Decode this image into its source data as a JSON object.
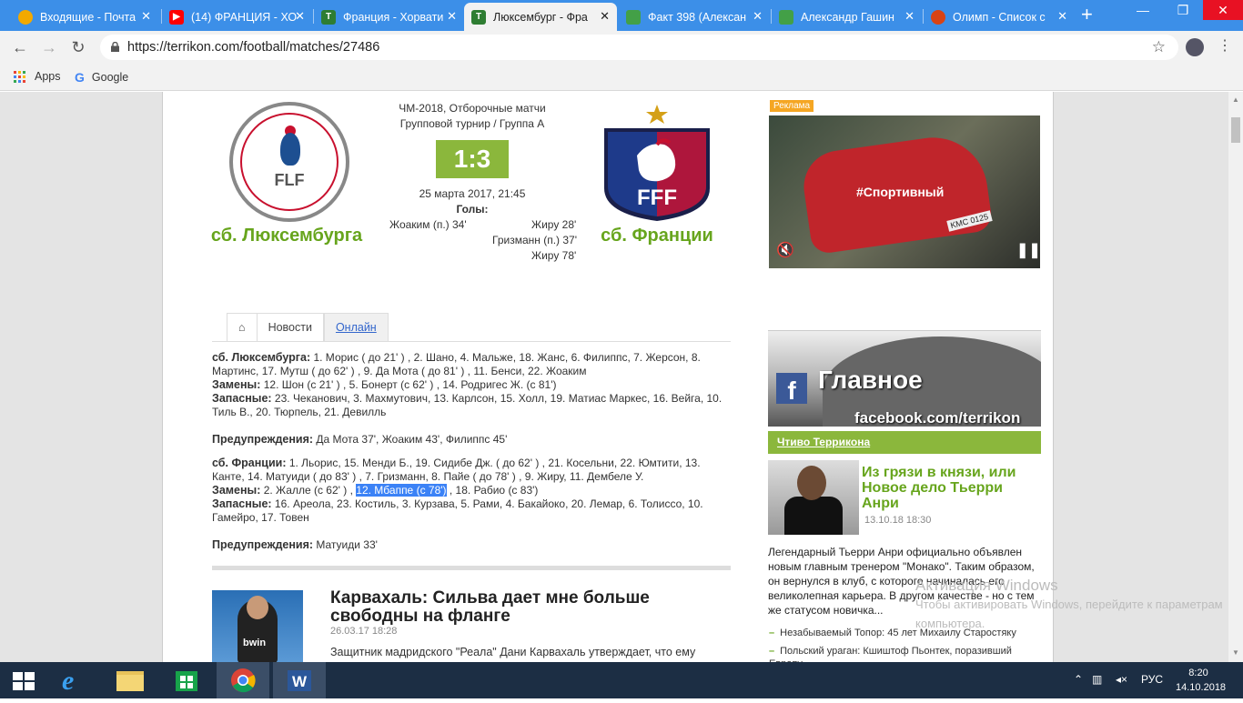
{
  "browser": {
    "tabs": [
      {
        "label": "Входящие - Почта",
        "icon_color": "#f2a900",
        "icon": "mail-icon"
      },
      {
        "label": "(14) ФРАНЦИЯ - ХО",
        "icon_color": "#ff0000",
        "icon": "youtube-icon"
      },
      {
        "label": "Франция - Хорвати",
        "icon_color": "#2e7d32",
        "icon": "terrikon-icon"
      },
      {
        "label": "Люксембург - Фра",
        "icon_color": "#2e7d32",
        "icon": "terrikon-icon",
        "active": true
      },
      {
        "label": "Факт 398 (Алексан",
        "icon_color": "#43a047",
        "icon": "sheet-icon"
      },
      {
        "label": "Александр Гашин",
        "icon_color": "#43a047",
        "icon": "sheet-icon"
      },
      {
        "label": "Олимп - Список с",
        "icon_color": "#d84315",
        "icon": "olimp-icon"
      }
    ],
    "new_tab": "+",
    "url": "https://terrikon.com/football/matches/27486",
    "bookmarks": [
      {
        "label": "Apps"
      },
      {
        "label": "Google"
      }
    ]
  },
  "match": {
    "competition": "ЧМ-2018, Отборочные матчи",
    "stage": "Групповой турнир / Группа А",
    "score": "1:3",
    "date": "25 марта 2017, 21:45",
    "goals_label": "Голы:",
    "home_goals": [
      "Жоаким (п.) 34'"
    ],
    "away_goals": [
      "Жиру 28'",
      "Гризманн (п.) 37'",
      "Жиру 78'"
    ],
    "home_team": "сб. Люксембурга",
    "away_team": "сб. Франции",
    "home_logo_text": "FLF",
    "away_logo_text": "FFF"
  },
  "news_tabs": [
    "Новости",
    "Онлайн"
  ],
  "lineups": {
    "home": {
      "team": "сб. Люксембурга:",
      "players": "1. Морис ( до 21' ) , 2. Шано, 4. Мальже, 18. Жанс, 6. Филиппс, 7. Жерсон, 8. Мартинс, 17. Мутш ( до 62' ) , 9. Да Мота ( до 81' ) , 11. Бенси, 22. Жоаким",
      "subs_label": "Замены:",
      "subs": "12. Шон (с 21' ) , 5. Бонерт (с 62' ) , 14. Родригес Ж. (с 81')",
      "reserves_label": "Запасные:",
      "reserves": "23. Чеканович, 3. Махмутович, 13. Карлсон, 15. Холл, 19. Матиас Маркес, 16. Вейга, 10. Тиль В., 20. Тюрпель, 21. Девилль",
      "warnings_label": "Предупреждения:",
      "warnings": "Да Мота 37', Жоаким 43', Филиппс 45'"
    },
    "away": {
      "team": "сб. Франции:",
      "players": "1. Льорис, 15. Менди Б., 19. Сидибе Дж. ( до 62' ) , 21. Косельни, 22. Юмтити, 13. Канте, 14. Матуиди ( до 83' ) , 7. Гризманн, 8. Пайе ( до 78' ) , 9. Жиру, 11. Дембеле У.",
      "subs_label": "Замены:",
      "subs_a": "2. Жалле (с 62' ) ,",
      "subs_highlight": "12. Мбаппе (с 78')",
      "subs_b": ", 18. Рабио (с 83')",
      "reserves_label": "Запасные:",
      "reserves": "16. Ареола, 23. Костиль, 3. Курзава, 5. Рами, 4. Бакайоко, 20. Лемар, 6. Толиссо, 10. Гамейро, 17. Товен",
      "warnings_label": "Предупреждения:",
      "warnings": "Матуиди 33'"
    }
  },
  "news": {
    "title": "Карвахаль: Сильва дает мне больше свободны на фланге",
    "date": "26.03.17 18:28",
    "text": "Защитник мадридского \"Реала\" Дани Карвахаль утверждает, что ему",
    "image_text": "bwin"
  },
  "sidebar": {
    "ad_label": "Реклама",
    "ad_text": "#Спортивный",
    "ad_plate": "KMC 0125",
    "fb_title": "Главное",
    "fb_url": "facebook.com/terrikon",
    "section": "Чтиво Терриконa",
    "article_title": "Из грязи в князи, или Новое дело Тьерри Анри",
    "article_date": "13.10.18 18:30",
    "article_text": "Легендарный Тьерри Анри официально объявлен новым главным тренером \"Монако\". Таким образом, он вернулся в клуб, с которого начиналась его великолепная карьера. В другом качестве - но с тем же статусом новичка...",
    "links": [
      "Незабываемый Топор: 45 лет Михаилу Старостяку",
      "Польский ураган: Кшиштоф Пьонтек, поразивший Европу"
    ]
  },
  "activation": {
    "title": "Активация Windows",
    "text": "Чтобы активировать Windows, перейдите к параметрам компьютера."
  },
  "taskbar": {
    "lang": "РУС",
    "time": "8:20",
    "date": "14.10.2018"
  },
  "colors": {
    "accent_green": "#67a51d",
    "score_bg": "#8bb73c",
    "tabbar": "#3c8fe8",
    "highlight": "#3b82f6"
  }
}
